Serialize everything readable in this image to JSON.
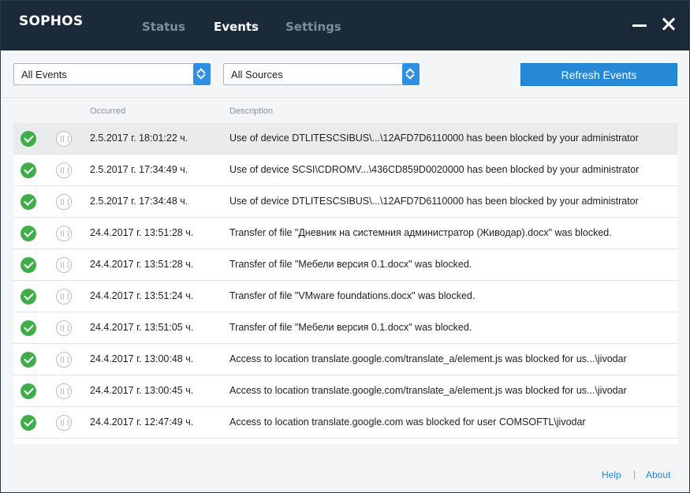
{
  "app": {
    "logo": "SOPHOS"
  },
  "nav": {
    "tabs": [
      {
        "label": "Status",
        "active": false
      },
      {
        "label": "Events",
        "active": true
      },
      {
        "label": "Settings",
        "active": false
      }
    ]
  },
  "toolbar": {
    "events_filter": "All Events",
    "sources_filter": "All Sources",
    "refresh_label": "Refresh Events",
    "accent_color": "#2589d8"
  },
  "table": {
    "columns": {
      "occurred": "Occurred",
      "description": "Description"
    },
    "rows": [
      {
        "date": "2.5.2017 г. 18:01:22 ч.",
        "description": "Use of device DTLITESCSIBUS\\...\\12AFD7D6110000 has been blocked by your administrator",
        "selected": true
      },
      {
        "date": "2.5.2017 г. 17:34:49 ч.",
        "description": "Use of device SCSI\\CDROMV...\\436CD859D0020000 has been blocked by your administrator",
        "selected": false
      },
      {
        "date": "2.5.2017 г. 17:34:48 ч.",
        "description": "Use of device DTLITESCSIBUS\\...\\12AFD7D6110000 has been blocked by your administrator",
        "selected": false
      },
      {
        "date": "24.4.2017 г. 13:51:28 ч.",
        "description": "Transfer of file \"Дневник на системния администратор (Живодар).docx\" was blocked.",
        "selected": false
      },
      {
        "date": "24.4.2017 г. 13:51:28 ч.",
        "description": "Transfer of file \"Мебели версия 0.1.docx\" was blocked.",
        "selected": false
      },
      {
        "date": "24.4.2017 г. 13:51:24 ч.",
        "description": "Transfer of file \"VMware foundations.docx\" was blocked.",
        "selected": false
      },
      {
        "date": "24.4.2017 г. 13:51:05 ч.",
        "description": "Transfer of file \"Мебели версия 0.1.docx\" was blocked.",
        "selected": false
      },
      {
        "date": "24.4.2017 г. 13:00:48 ч.",
        "description": "Access to location translate.google.com/translate_a/element.js was blocked for us...\\jivodar",
        "selected": false
      },
      {
        "date": "24.4.2017 г. 13:00:45 ч.",
        "description": "Access to location translate.google.com/translate_a/element.js was blocked for us...\\jivodar",
        "selected": false
      },
      {
        "date": "24.4.2017 г. 12:47:49 ч.",
        "description": "Access to location translate.google.com was blocked for user COMSOFTL\\jivodar",
        "selected": false
      }
    ]
  },
  "footer": {
    "help": "Help",
    "separator": "|",
    "about": "About"
  }
}
